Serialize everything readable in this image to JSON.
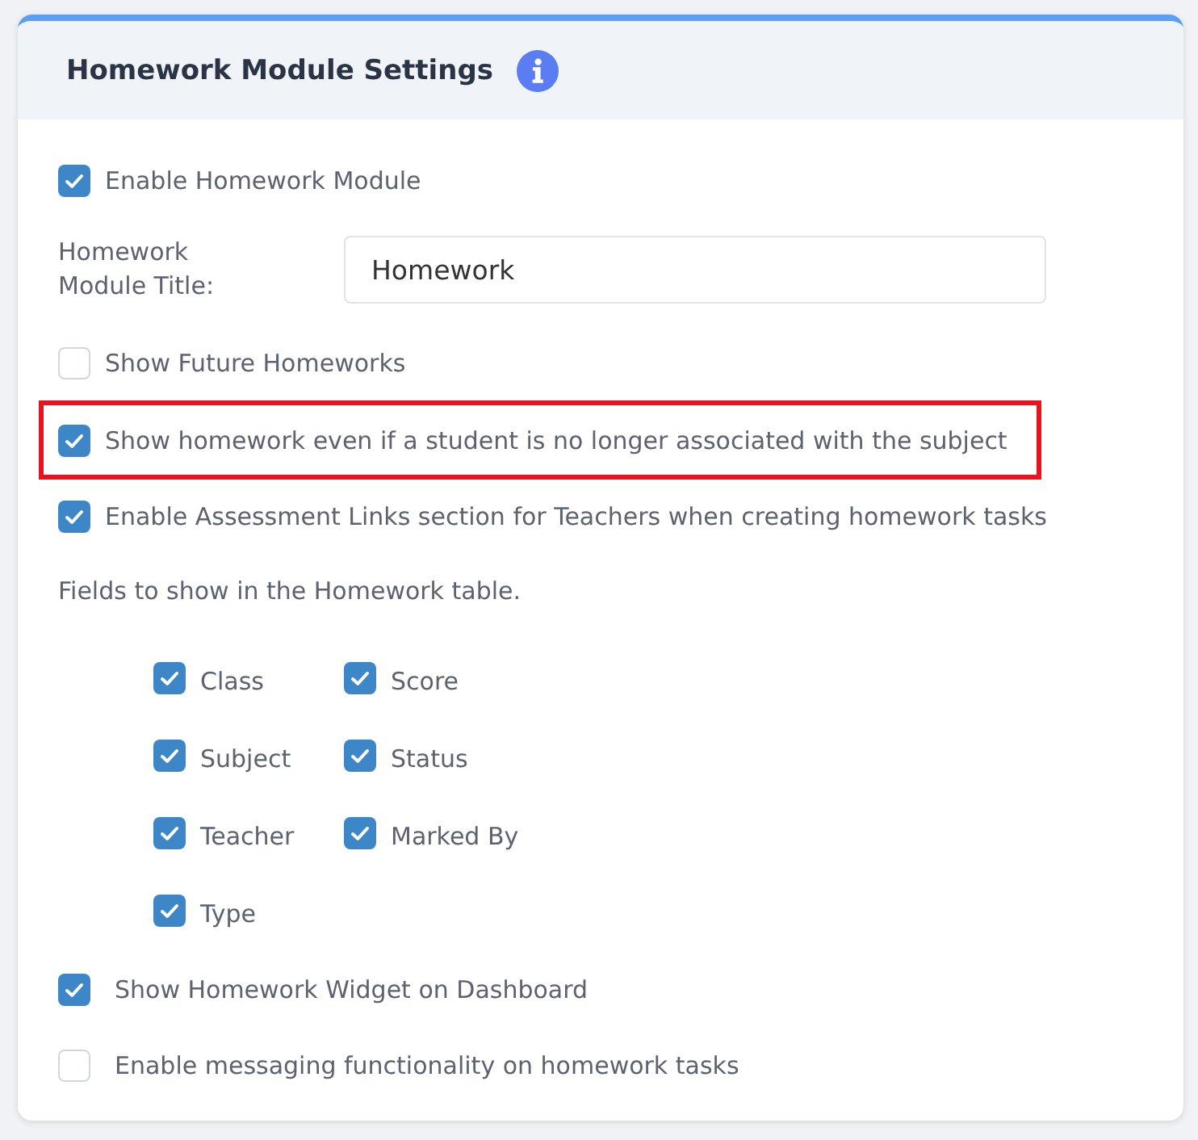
{
  "panel": {
    "title": "Homework Module Settings"
  },
  "options": [
    {
      "kind": "checkbox",
      "label": "Enable Homework Module",
      "checked": true,
      "highlighted": false
    },
    {
      "kind": "text_field",
      "label": "Homework Module Title:",
      "value": "Homework"
    },
    {
      "kind": "checkbox",
      "label": "Show Future Homeworks",
      "checked": false,
      "highlighted": false
    },
    {
      "kind": "checkbox",
      "label": "Show homework even if a student is no longer associated with the subject",
      "checked": true,
      "highlighted": true
    },
    {
      "kind": "checkbox",
      "label": "Enable Assessment Links section for Teachers when creating homework tasks",
      "checked": true,
      "highlighted": false
    },
    {
      "kind": "field_grid",
      "label": "Fields to show in the Homework table.",
      "fields": [
        {
          "label": "Class",
          "checked": true
        },
        {
          "label": "Score",
          "checked": true
        },
        {
          "label": "Subject",
          "checked": true
        },
        {
          "label": "Status",
          "checked": true
        },
        {
          "label": "Teacher",
          "checked": true
        },
        {
          "label": "Marked By",
          "checked": true
        },
        {
          "label": "Type",
          "checked": true
        }
      ]
    },
    {
      "kind": "checkbox",
      "label": "Show Homework Widget on Dashboard",
      "checked": true,
      "highlighted": false
    },
    {
      "kind": "checkbox",
      "label": "Enable messaging functionality on homework tasks",
      "checked": false,
      "highlighted": false
    }
  ]
}
